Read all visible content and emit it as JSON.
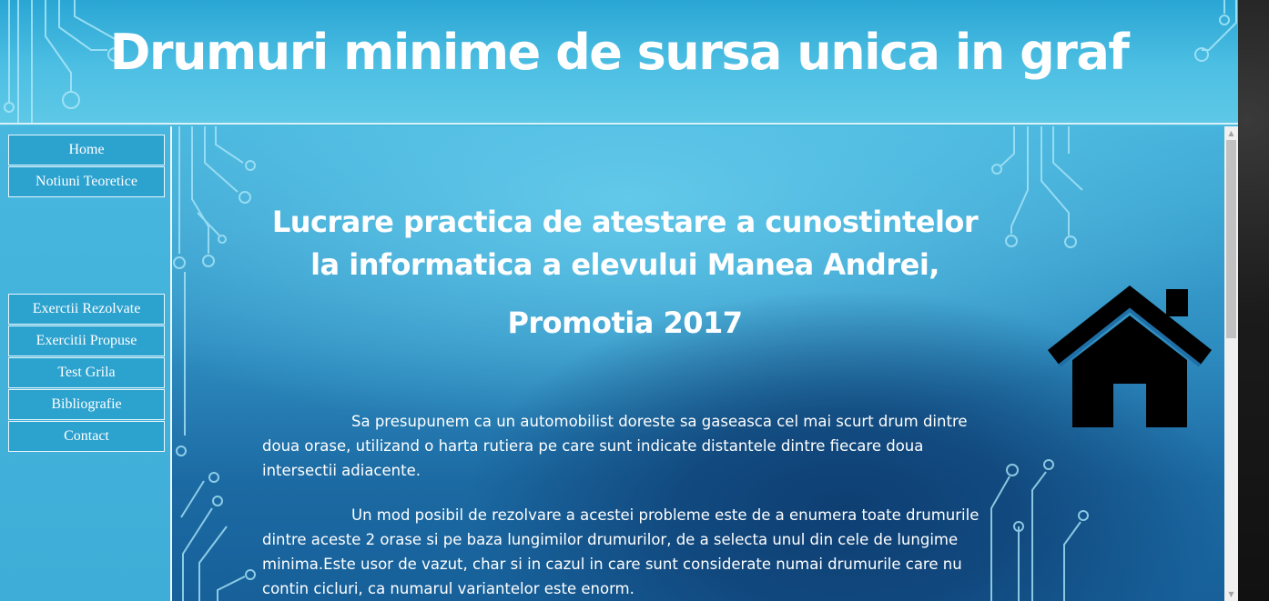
{
  "header": {
    "title": "Drumuri minime de sursa unica in graf"
  },
  "sidebar": {
    "top_items": [
      {
        "label": "Home"
      },
      {
        "label": "Notiuni Teoretice"
      }
    ],
    "bottom_items": [
      {
        "label": "Exerctii Rezolvate"
      },
      {
        "label": "Exercitii Propuse"
      },
      {
        "label": "Test Grila"
      },
      {
        "label": "Bibliografie"
      },
      {
        "label": "Contact"
      }
    ]
  },
  "main": {
    "title_line1": "Lucrare practica de atestare a cunostintelor",
    "title_line2": "la informatica a elevului Manea Andrei,",
    "title_line3": "Promotia 2017",
    "paragraph1": "Sa presupunem ca un automobilist doreste sa gaseasca cel mai scurt drum dintre doua orase, utilizand o harta rutiera pe care sunt indicate distantele dintre fiecare doua intersectii adiacente.",
    "paragraph2": "Un mod posibil de rezolvare a acestei probleme este de a enumera toate drumurile dintre aceste 2 orase si pe baza lungimilor drumurilor, de a selecta unul din cele de lungime minima.Este usor de vazut, char si in cazul in care sunt considerate numai drumurile care nu contin cicluri, ca numarul variantelor este enorm.",
    "home_icon": "home-icon"
  },
  "colors": {
    "header_bg": "#4dbfe3",
    "nav_button_bg": "#2ca2cf",
    "text": "#ffffff",
    "content_dark": "#17609a"
  }
}
